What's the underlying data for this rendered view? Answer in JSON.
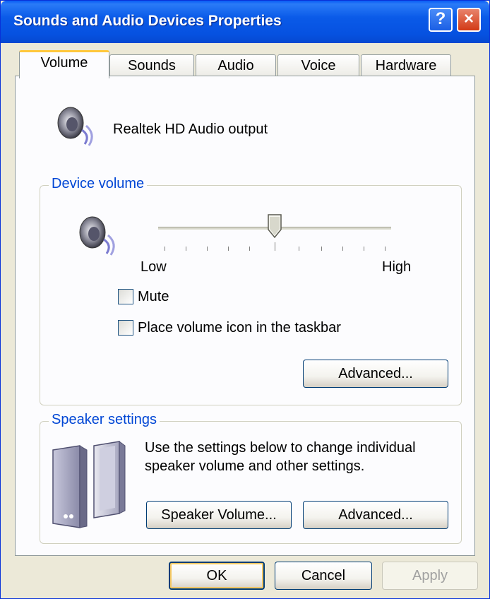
{
  "window": {
    "title": "Sounds and Audio Devices Properties",
    "help_label": "?",
    "close_label": "×"
  },
  "tabs": [
    {
      "label": "Volume",
      "active": true
    },
    {
      "label": "Sounds",
      "active": false
    },
    {
      "label": "Audio",
      "active": false
    },
    {
      "label": "Voice",
      "active": false
    },
    {
      "label": "Hardware",
      "active": false
    }
  ],
  "device": {
    "name": "Realtek HD Audio output",
    "icon": "speaker-icon"
  },
  "device_volume": {
    "group_title": "Device volume",
    "icon": "speaker-icon",
    "slider": {
      "low_label": "Low",
      "high_label": "High",
      "level": 0.5
    },
    "mute_label": "Mute",
    "mute_checked": false,
    "taskbar_label": "Place volume icon in the taskbar",
    "taskbar_checked": false,
    "advanced_label": "Advanced..."
  },
  "speaker_settings": {
    "group_title": "Speaker settings",
    "icon": "speakers-icon",
    "description_line1": "Use the settings below to change individual",
    "description_line2": "speaker volume and other settings.",
    "speaker_volume_label": "Speaker Volume...",
    "advanced_label": "Advanced..."
  },
  "footer": {
    "ok_label": "OK",
    "cancel_label": "Cancel",
    "apply_label": "Apply",
    "apply_enabled": false
  },
  "colors": {
    "titlebar": "#0a5ae8",
    "dialog_bg": "#ece9d8",
    "group_title": "#0046d5",
    "active_tab_accent": "#ffc83c"
  }
}
